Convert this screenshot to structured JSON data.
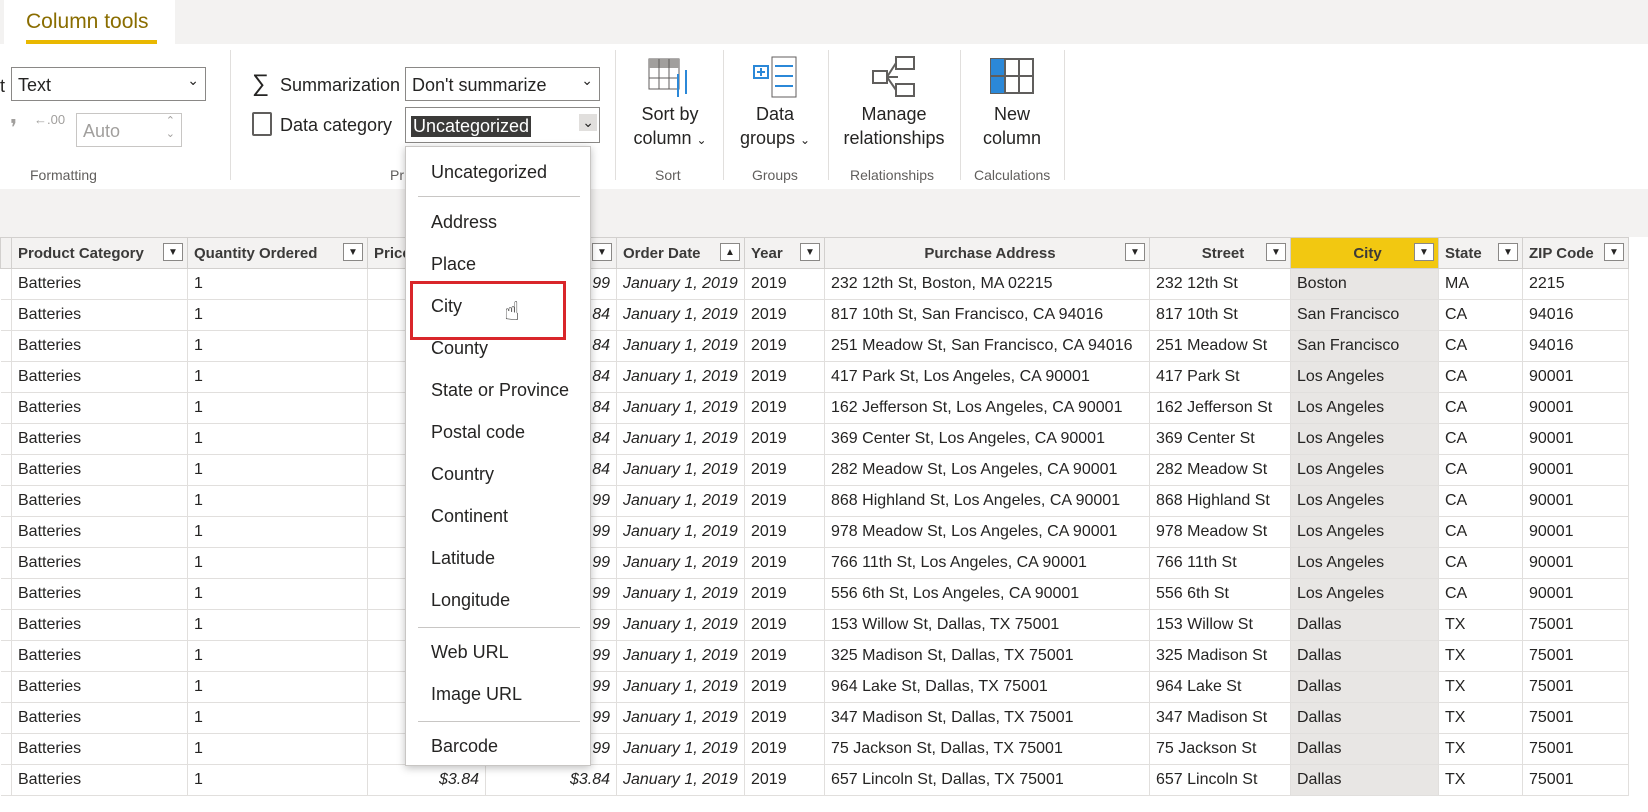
{
  "ribbon": {
    "active_tab": "Column tools",
    "format_value": "Text",
    "format_label_partial": "t",
    "decimal_value": "Auto",
    "summarization_label": "Summarization",
    "summarization_value": "Don't summarize",
    "data_category_label": "Data category",
    "data_category_value": "Uncategorized",
    "groups": {
      "formatting": "Formatting",
      "properties_partial": "Pr",
      "sort": "Sort",
      "groups": "Groups",
      "relationships": "Relationships",
      "calculations": "Calculations"
    },
    "buttons": {
      "sort_by_column": [
        "Sort by",
        "column"
      ],
      "data_groups": [
        "Data",
        "groups"
      ],
      "manage_relationships": [
        "Manage",
        "relationships"
      ],
      "new_column": [
        "New",
        "column"
      ]
    }
  },
  "dropdown": {
    "items": [
      "Uncategorized",
      "Address",
      "Place",
      "City",
      "County",
      "State or Province",
      "Postal code",
      "Country",
      "Continent",
      "Latitude",
      "Longitude",
      "Web URL",
      "Image URL",
      "Barcode"
    ],
    "selected": "City"
  },
  "table": {
    "columns": [
      "Product Category",
      "Quantity Ordered",
      "Price",
      "",
      "Order Date",
      "Year",
      "Purchase Address",
      "Street",
      "City",
      "State",
      "ZIP Code"
    ],
    "rows": [
      [
        "Batteries",
        "1",
        "",
        "99",
        "January 1, 2019",
        "2019",
        "232 12th St, Boston, MA 02215",
        "232 12th St",
        "Boston",
        "MA",
        "2215"
      ],
      [
        "Batteries",
        "1",
        "",
        "84",
        "January 1, 2019",
        "2019",
        "817 10th St, San Francisco, CA 94016",
        "817 10th St",
        "San Francisco",
        "CA",
        "94016"
      ],
      [
        "Batteries",
        "1",
        "",
        "84",
        "January 1, 2019",
        "2019",
        "251 Meadow St, San Francisco, CA 94016",
        "251 Meadow St",
        "San Francisco",
        "CA",
        "94016"
      ],
      [
        "Batteries",
        "1",
        "",
        "84",
        "January 1, 2019",
        "2019",
        "417 Park St, Los Angeles, CA 90001",
        "417 Park St",
        "Los Angeles",
        "CA",
        "90001"
      ],
      [
        "Batteries",
        "1",
        "",
        "84",
        "January 1, 2019",
        "2019",
        "162 Jefferson St, Los Angeles, CA 90001",
        "162 Jefferson St",
        "Los Angeles",
        "CA",
        "90001"
      ],
      [
        "Batteries",
        "1",
        "",
        "84",
        "January 1, 2019",
        "2019",
        "369 Center St, Los Angeles, CA 90001",
        "369 Center St",
        "Los Angeles",
        "CA",
        "90001"
      ],
      [
        "Batteries",
        "1",
        "",
        "84",
        "January 1, 2019",
        "2019",
        "282 Meadow St, Los Angeles, CA 90001",
        "282 Meadow St",
        "Los Angeles",
        "CA",
        "90001"
      ],
      [
        "Batteries",
        "1",
        "",
        "99",
        "January 1, 2019",
        "2019",
        "868 Highland St, Los Angeles, CA 90001",
        "868 Highland St",
        "Los Angeles",
        "CA",
        "90001"
      ],
      [
        "Batteries",
        "1",
        "",
        "99",
        "January 1, 2019",
        "2019",
        "978 Meadow St, Los Angeles, CA 90001",
        "978 Meadow St",
        "Los Angeles",
        "CA",
        "90001"
      ],
      [
        "Batteries",
        "1",
        "",
        "99",
        "January 1, 2019",
        "2019",
        "766 11th St, Los Angeles, CA 90001",
        "766 11th St",
        "Los Angeles",
        "CA",
        "90001"
      ],
      [
        "Batteries",
        "1",
        "",
        "99",
        "January 1, 2019",
        "2019",
        "556 6th St, Los Angeles, CA 90001",
        "556 6th St",
        "Los Angeles",
        "CA",
        "90001"
      ],
      [
        "Batteries",
        "1",
        "",
        "99",
        "January 1, 2019",
        "2019",
        "153 Willow St, Dallas, TX 75001",
        "153 Willow St",
        "Dallas",
        "TX",
        "75001"
      ],
      [
        "Batteries",
        "1",
        "",
        "99",
        "January 1, 2019",
        "2019",
        "325 Madison St, Dallas, TX 75001",
        "325 Madison St",
        "Dallas",
        "TX",
        "75001"
      ],
      [
        "Batteries",
        "1",
        "",
        "99",
        "January 1, 2019",
        "2019",
        "964 Lake St, Dallas, TX 75001",
        "964 Lake St",
        "Dallas",
        "TX",
        "75001"
      ],
      [
        "Batteries",
        "1",
        "",
        "99",
        "January 1, 2019",
        "2019",
        "347 Madison St, Dallas, TX 75001",
        "347 Madison St",
        "Dallas",
        "TX",
        "75001"
      ],
      [
        "Batteries",
        "1",
        "",
        "99",
        "January 1, 2019",
        "2019",
        "75 Jackson St, Dallas, TX 75001",
        "75 Jackson St",
        "Dallas",
        "TX",
        "75001"
      ],
      [
        "Batteries",
        "1",
        "$3.84",
        "$3.84",
        "January 1, 2019",
        "2019",
        "657 Lincoln St, Dallas, TX 75001",
        "657 Lincoln St",
        "Dallas",
        "TX",
        "75001"
      ]
    ]
  }
}
